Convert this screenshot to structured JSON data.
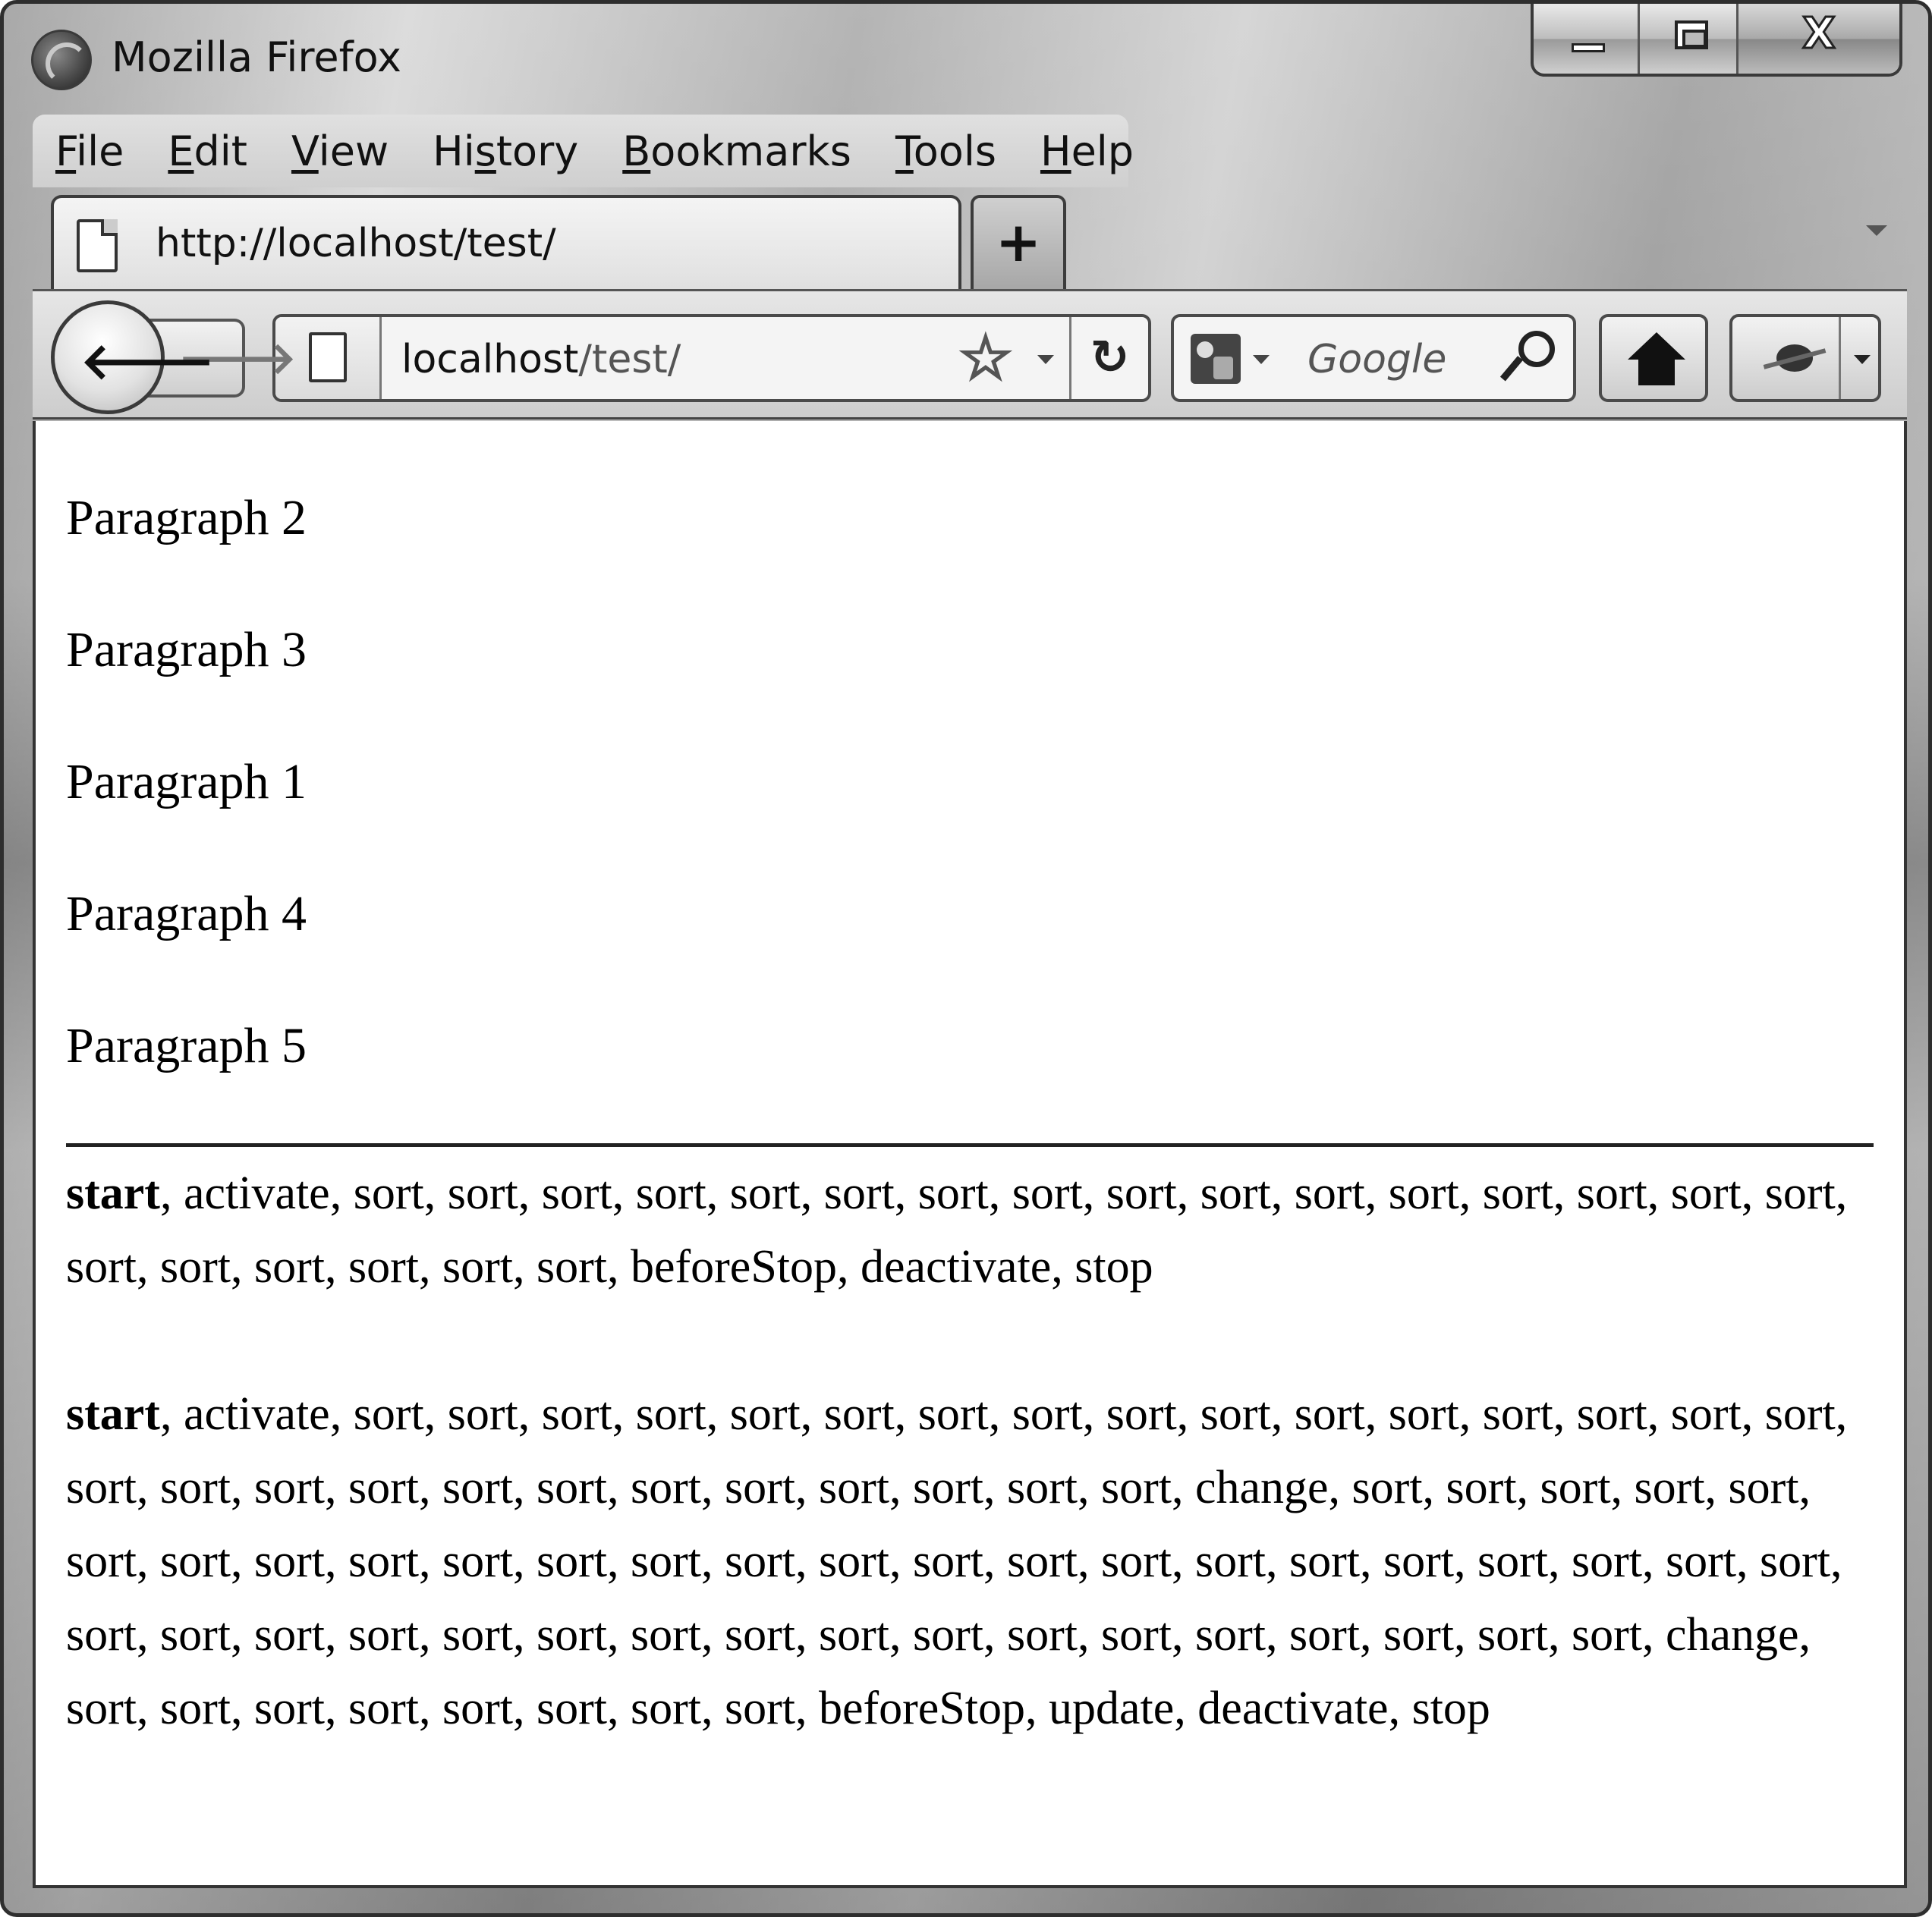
{
  "window": {
    "title": "Mozilla Firefox",
    "controls": {
      "close_glyph": "X"
    }
  },
  "menubar": {
    "items": [
      {
        "accel": "F",
        "rest": "ile"
      },
      {
        "accel": "E",
        "rest": "dit"
      },
      {
        "accel": "V",
        "rest": "iew"
      },
      {
        "before": "Hi",
        "accel": "s",
        "rest": "tory"
      },
      {
        "accel": "B",
        "rest": "ookmarks"
      },
      {
        "accel": "T",
        "rest": "ools"
      },
      {
        "accel": "H",
        "rest": "elp"
      }
    ]
  },
  "tabs": {
    "active": {
      "label": "http://localhost/test/",
      "icon": "page-icon"
    },
    "new_tab_label": "+"
  },
  "navbar": {
    "back_glyph": "🡐",
    "forward_glyph": "🡒",
    "url": {
      "host": "localhost",
      "path": "/test/"
    },
    "bookmark_star_glyph": "☆",
    "reload_glyph": "↻",
    "search": {
      "engine_icon": "google-icon",
      "placeholder": "Google"
    },
    "home_icon": "home-icon",
    "addon_icon": "firebug-icon"
  },
  "content": {
    "paragraphs": [
      "Paragraph 2",
      "Paragraph 3",
      "Paragraph 1",
      "Paragraph 4",
      "Paragraph 5"
    ],
    "event_logs": [
      {
        "first": "start",
        "rest": ", activate, sort, sort, sort, sort, sort, sort, sort, sort, sort, sort, sort, sort, sort, sort, sort, sort, sort, sort, sort, sort, sort, sort, beforeStop, deactivate, stop"
      },
      {
        "first": "start",
        "rest": ", activate, sort, sort, sort, sort, sort, sort, sort, sort, sort, sort, sort, sort, sort, sort, sort, sort, sort, sort, sort, sort, sort, sort, sort, sort, sort, sort, sort, sort, change, sort, sort, sort, sort, sort, sort, sort, sort, sort, sort, sort, sort, sort, sort, sort, sort, sort, sort, sort, sort, sort, sort, sort, sort, sort, sort, sort, sort, sort, sort, sort, sort, sort, sort, sort, sort, sort, sort, sort, sort, sort, change, sort, sort, sort, sort, sort, sort, sort, sort, beforeStop, update, deactivate, stop"
      }
    ]
  }
}
